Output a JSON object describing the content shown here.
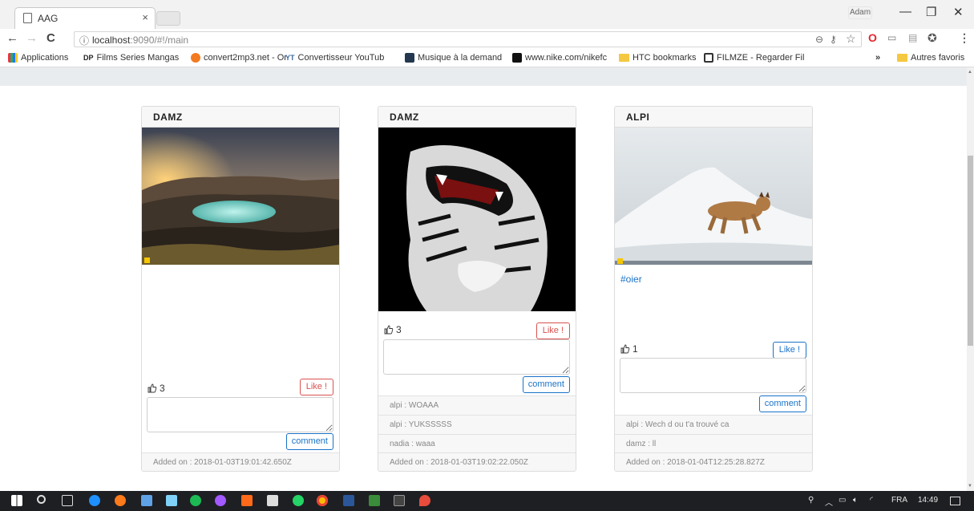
{
  "browser": {
    "tab_title": "AAG",
    "tab_close": "×",
    "profile_name": "Adam",
    "window_controls": {
      "minimize": "—",
      "maximize": "❐",
      "close": "✕"
    },
    "nav": {
      "back": "←",
      "forward": "→",
      "reload": "C"
    },
    "url_host": "localhost",
    "url_path": ":9090/#!/main",
    "omnibox_icons": [
      "zoom-icon",
      "key-icon",
      "star-icon"
    ],
    "bookmarks": [
      {
        "label": "Applications",
        "icon": "apps-grid-icon"
      },
      {
        "label": "Films Series Mangas",
        "icon": "dp-icon"
      },
      {
        "label": "convert2mp3.net - Or",
        "icon": "convert2mp3-icon"
      },
      {
        "label": "Convertisseur YouTub",
        "icon": "yt-converter-icon"
      },
      {
        "label": "Musique à la demand",
        "icon": "music-icon"
      },
      {
        "label": "www.nike.com/nikefc",
        "icon": "nike-icon"
      },
      {
        "label": "HTC bookmarks",
        "icon": "folder-icon"
      },
      {
        "label": "FILMZE - Regarder Fil",
        "icon": "film-icon"
      }
    ],
    "more_bookmarks": "»",
    "other_bookmarks": "Autres favoris"
  },
  "posts": [
    {
      "author": "DAMZ",
      "hashtag": "",
      "likes": "3",
      "like_label": "Like !",
      "like_style": "red",
      "comment_label": "comment",
      "comments": [],
      "added_on": "Added on : 2018-01-03T19:01:42.650Z"
    },
    {
      "author": "DAMZ",
      "hashtag": "",
      "likes": "3",
      "like_label": "Like !",
      "like_style": "red",
      "comment_label": "comment",
      "comments": [
        "alpi : WOAAA",
        "alpi : YUKSSSSS",
        "nadia : waaa"
      ],
      "added_on": "Added on : 2018-01-03T19:02:22.050Z"
    },
    {
      "author": "ALPI",
      "hashtag": "#oier",
      "likes": "1",
      "like_label": "Like !",
      "like_style": "blue",
      "comment_label": "comment",
      "comments": [
        "alpi : Wech d ou t'a trouvé ca",
        "damz : ll"
      ],
      "added_on": "Added on : 2018-01-04T12:25:28.827Z"
    }
  ],
  "taskbar": {
    "language": "FRA",
    "time": "14:49"
  },
  "colors": {
    "accent_blue": "#1a73c8",
    "like_red": "#d9534f",
    "taskbar": "#1e1f23"
  }
}
